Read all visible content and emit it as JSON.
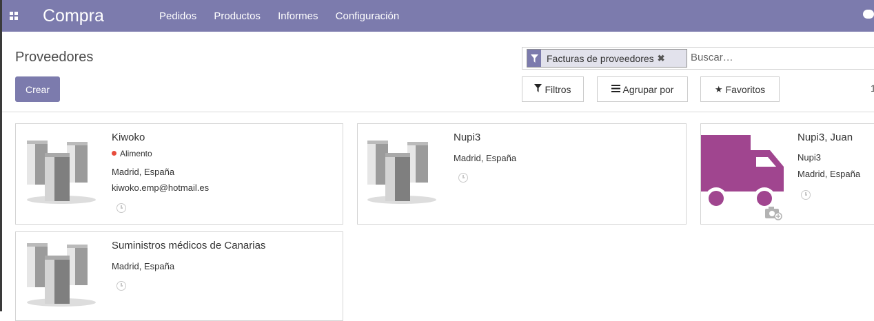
{
  "app": {
    "name": "Compra"
  },
  "nav": {
    "menu": [
      "Pedidos",
      "Productos",
      "Informes",
      "Configuración"
    ]
  },
  "breadcrumb": {
    "title": "Proveedores"
  },
  "actions": {
    "create_label": "Crear"
  },
  "search": {
    "facet_label": "Facturas de proveedores",
    "facet_remove": "✖",
    "placeholder": "Buscar…"
  },
  "toolbar": {
    "filters_label": "Filtros",
    "groupby_label": "Agrupar por",
    "favorites_label": "Favoritos",
    "pager_value": "1"
  },
  "colors": {
    "brand": "#7c7bad",
    "truck": "#a0458f",
    "tag_dot": "#e74c3c"
  },
  "cards": [
    {
      "name": "Kiwoko",
      "tag": "Alimento",
      "location": "Madrid, España",
      "email": "kiwoko.emp@hotmail.es",
      "image": "company-building-icon"
    },
    {
      "name": "Nupi3",
      "location": "Madrid, España",
      "image": "company-building-icon"
    },
    {
      "name": "Nupi3, Juan",
      "company": "Nupi3",
      "location": "Madrid, España",
      "image": "delivery-truck-icon"
    },
    {
      "name": "Suministros médicos de Canarias",
      "location": "Madrid, España",
      "image": "company-building-icon"
    }
  ]
}
